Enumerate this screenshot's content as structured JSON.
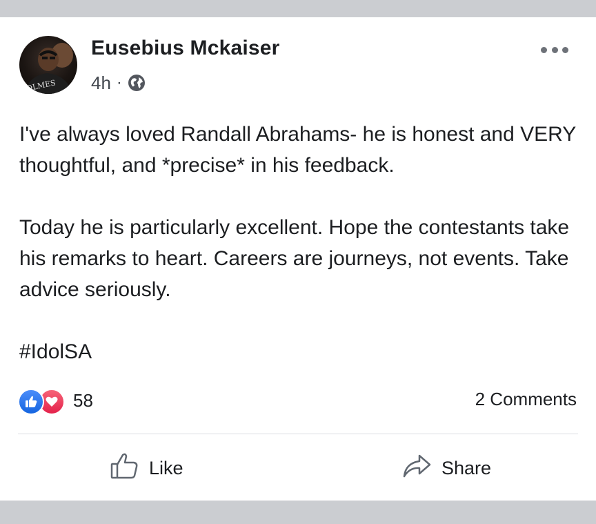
{
  "post": {
    "author": "Eusebius Mckaiser",
    "time": "4h",
    "separator": "·",
    "privacy_icon": "globe-icon",
    "avatar_shirt_text": "OLMES",
    "paragraphs": [
      "I've always loved Randall Abrahams- he is honest and VERY thoughtful, and *precise* in his feedback.",
      "Today he is particularly excellent. Hope the contestants take his remarks to heart. Careers are journeys, not events. Take advice seriously.",
      "#IdolSA"
    ]
  },
  "stats": {
    "reaction_icons": [
      "like-reaction-icon",
      "love-reaction-icon"
    ],
    "reaction_count": "58",
    "comments": "2 Comments"
  },
  "actions": {
    "like_label": "Like",
    "share_label": "Share"
  },
  "colors": {
    "background": "#cbcdd1",
    "card": "#ffffff",
    "text": "#1c1e21",
    "like_blue": "#1877f2",
    "love_red": "#f0284a"
  }
}
